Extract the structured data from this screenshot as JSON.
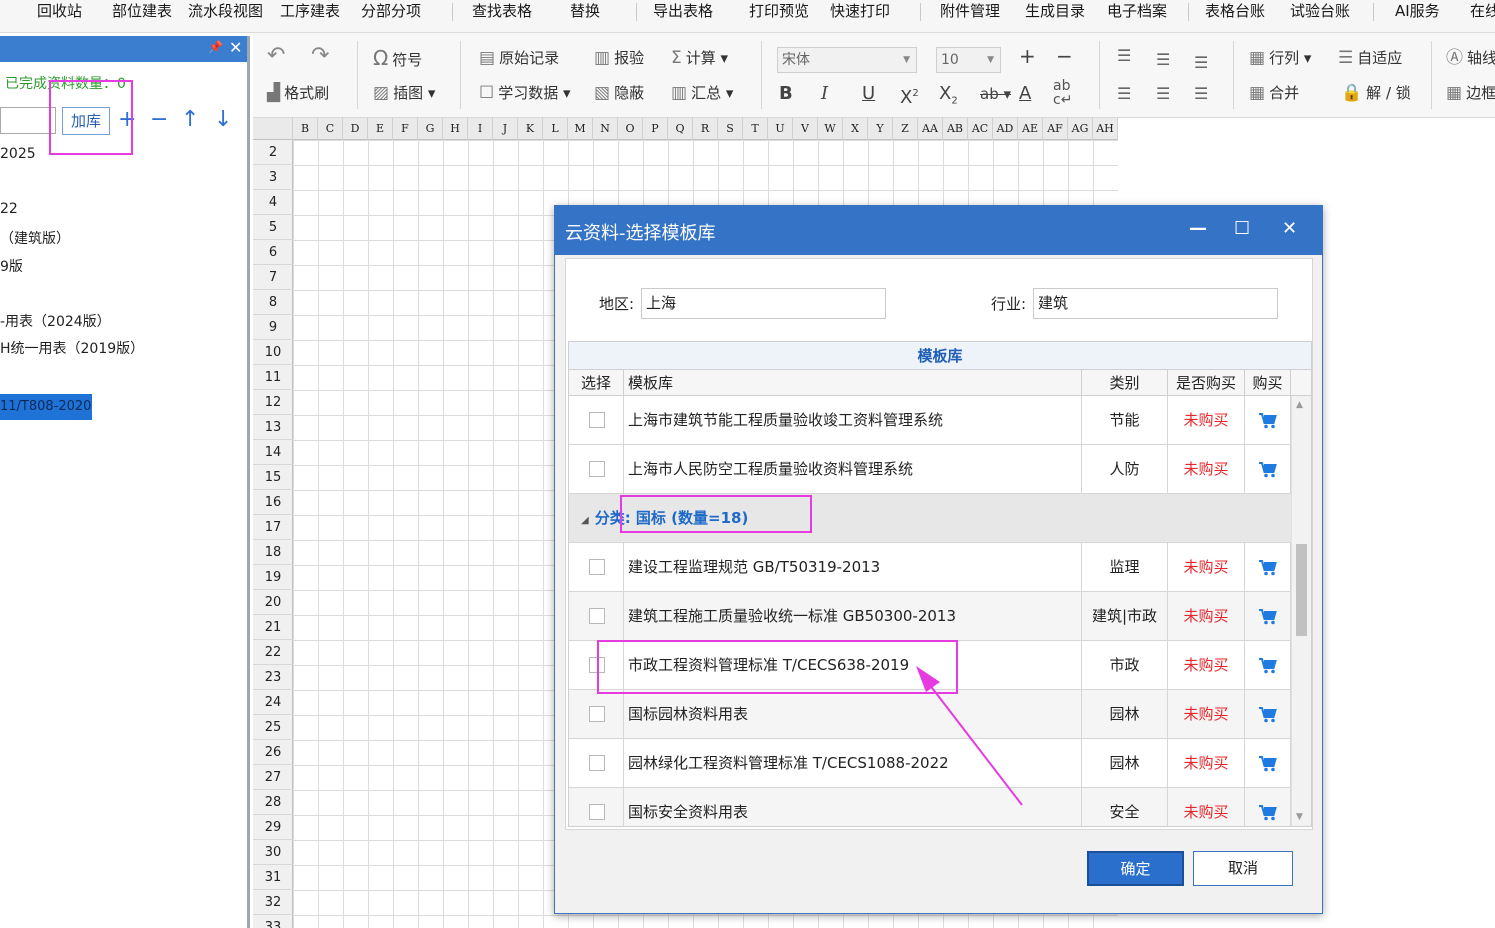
{
  "menu": [
    "回收站",
    "部位建表",
    "流水段视图",
    "工序建表",
    "分部分项",
    "查找表格",
    "替换",
    "导出表格",
    "打印预览",
    "快速打印",
    "附件管理",
    "生成目录",
    "电子档案",
    "表格台账",
    "试验台账",
    "AI服务",
    "在线"
  ],
  "left_panel": {
    "pin": "📌",
    "close": "✕",
    "completed_count": "已完成资料数量：0",
    "add_lib": "加库",
    "plus": "+",
    "minus": "−",
    "up": "↑",
    "down": "↓",
    "tree": [
      "2025",
      "22",
      "（建筑版）",
      "9版",
      "-用表（2024版）",
      "H统一用表（2019版）"
    ],
    "selected": "11/T808-2020"
  },
  "toolbar": {
    "undo": "↶",
    "redo": "↷",
    "symbol": "符号",
    "format_painter": "格式刷",
    "insert_image": "插图",
    "original_record": "原始记录",
    "study_data": "学习数据",
    "report_check": "报验",
    "hide": "隐蔽",
    "calculate": "计算",
    "summary": "汇总",
    "font": "宋体",
    "font_size": "10",
    "row_col": "行列",
    "auto_fit": "自适应",
    "merge": "合并",
    "lock_unlock": "解 / 锁",
    "axis": "轴线",
    "border": "边框"
  },
  "sheet": {
    "columns": [
      "B",
      "C",
      "D",
      "E",
      "F",
      "G",
      "H",
      "I",
      "J",
      "K",
      "L",
      "M",
      "N",
      "O",
      "P",
      "Q",
      "R",
      "S",
      "T",
      "U",
      "V",
      "W",
      "X",
      "Y",
      "Z",
      "AA",
      "AB",
      "AC",
      "AD",
      "AE",
      "AF",
      "AG",
      "AH"
    ],
    "rows": [
      "2",
      "3",
      "4",
      "5",
      "6",
      "7",
      "8",
      "9",
      "10",
      "11",
      "12",
      "13",
      "14",
      "15",
      "16",
      "17",
      "18",
      "19",
      "20",
      "21",
      "22",
      "23",
      "24",
      "25",
      "26",
      "27",
      "28",
      "29",
      "30",
      "31",
      "32",
      "33"
    ]
  },
  "dialog": {
    "title": "云资料-选择模板库",
    "minimize": "—",
    "maximize": "☐",
    "close": "✕",
    "region_label": "地区:",
    "region_value": "上海",
    "industry_label": "行业:",
    "industry_value": "建筑",
    "table_caption": "模板库",
    "headers": [
      "选择",
      "模板库",
      "类别",
      "是否购买",
      "购买"
    ],
    "rows_top": [
      {
        "name": "上海市建筑节能工程质量验收竣工资料管理系统",
        "category": "节能",
        "status": "未购买"
      },
      {
        "name": "上海市人民防空工程质量验收资料管理系统",
        "category": "人防",
        "status": "未购买"
      }
    ],
    "group_label": "分类: 国标 (数量=18)",
    "rows_bottom": [
      {
        "name": "建设工程监理规范 GB/T50319-2013",
        "category": "监理",
        "status": "未购买"
      },
      {
        "name": "建筑工程施工质量验收统一标准 GB50300-2013",
        "category": "建筑|市政",
        "status": "未购买"
      },
      {
        "name": "市政工程资料管理标准 T/CECS638-2019",
        "category": "市政",
        "status": "未购买"
      },
      {
        "name": "国标园林资料用表",
        "category": "园林",
        "status": "未购买"
      },
      {
        "name": "园林绿化工程资料管理标准 T/CECS1088-2022",
        "category": "园林",
        "status": "未购买"
      },
      {
        "name": "国标安全资料用表",
        "category": "安全",
        "status": "未购买"
      }
    ],
    "ok": "确定",
    "cancel": "取消"
  },
  "colors": {
    "title_bar": "#3473c6",
    "not_purchased": "#e8262a",
    "cart": "#1f7be0",
    "highlight": "#e53be0"
  }
}
